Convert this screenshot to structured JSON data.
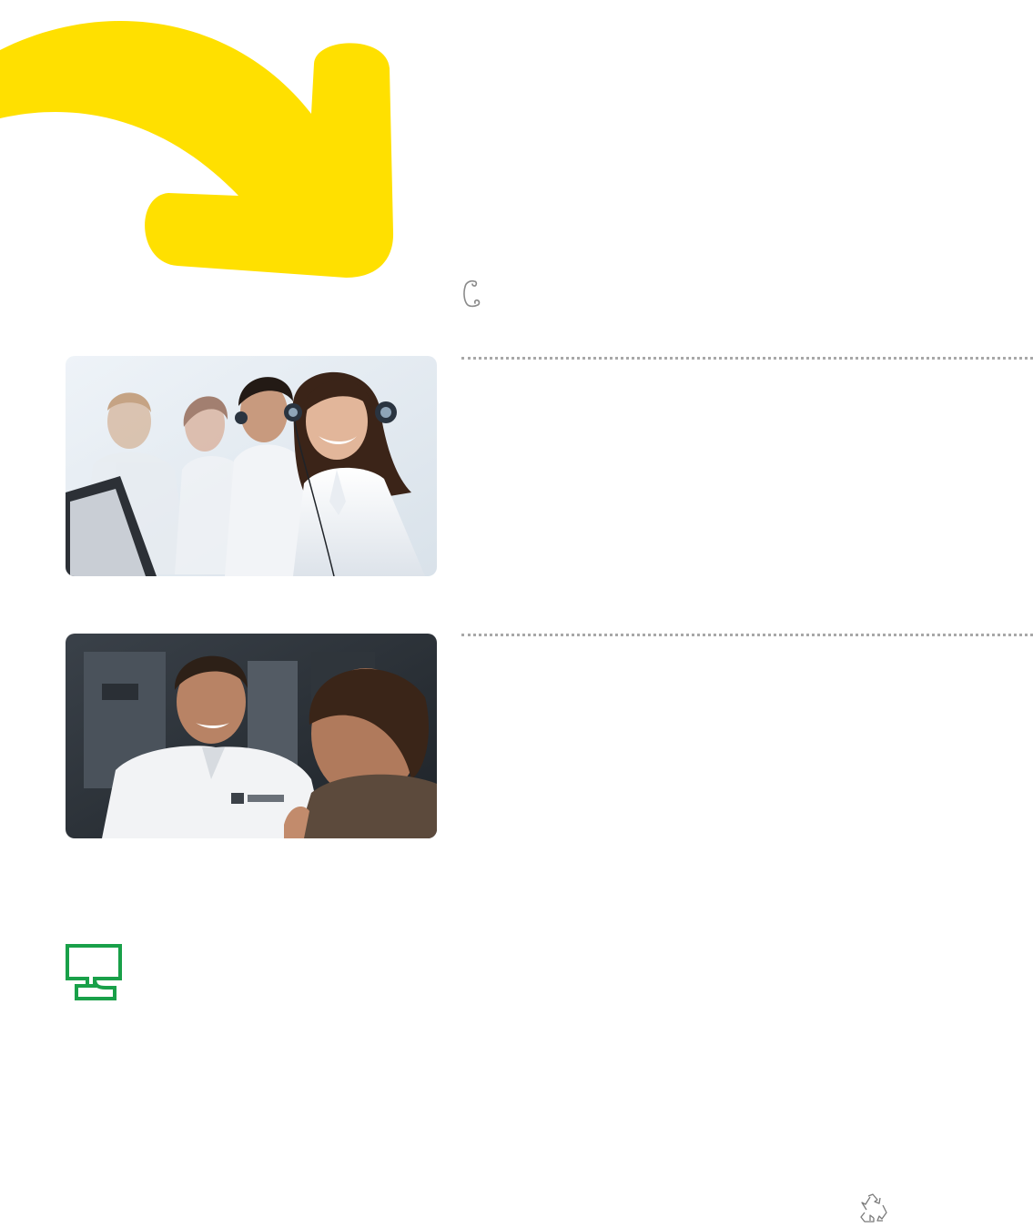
{
  "page": {
    "background": "#ffffff",
    "accent_yellow": "#FFE000",
    "accent_green": "#19A049"
  },
  "decor": {
    "arrow_icon": "curved-arrow-icon",
    "phone_icon": "phone-handset-icon",
    "screen_icon": "monitor-icon",
    "recycle_icon": "recycle-icon"
  },
  "photos": [
    {
      "name": "call-center-photo",
      "icon": "photo"
    },
    {
      "name": "technician-photo",
      "icon": "photo"
    }
  ]
}
